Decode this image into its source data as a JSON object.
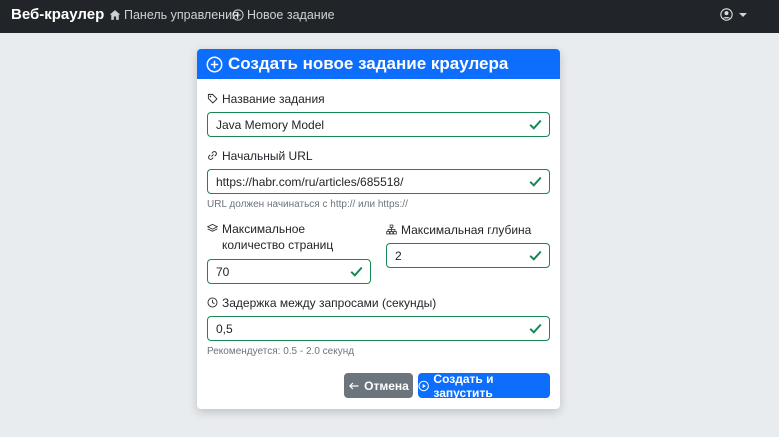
{
  "navbar": {
    "brand": "Веб-краулер",
    "links": [
      {
        "label": "Панель управления",
        "icon": "house-icon"
      },
      {
        "label": "Новое задание",
        "icon": "plus-circle-icon"
      }
    ],
    "user_icon": "user-circle-icon"
  },
  "form": {
    "title": "Создать новое задание краулера",
    "task_name": {
      "label": "Название задания",
      "value": "Java Memory Model"
    },
    "start_url": {
      "label": "Начальный URL",
      "value": "https://habr.com/ru/articles/685518/",
      "help": "URL должен начинаться с http:// или https://"
    },
    "max_pages": {
      "label": "Максимальное количество страниц",
      "value": "70"
    },
    "max_depth": {
      "label": "Максимальная глубина",
      "value": "2"
    },
    "delay": {
      "label": "Задержка между запросами (секунды)",
      "value": "0,5",
      "help": "Рекомендуется: 0.5 - 2.0 секунд"
    },
    "cancel_label": "Отмена",
    "submit_label": "Создать и запустить"
  },
  "colors": {
    "primary": "#0d6efd",
    "success": "#198754",
    "secondary": "#6c757d",
    "navbar": "#212529"
  }
}
